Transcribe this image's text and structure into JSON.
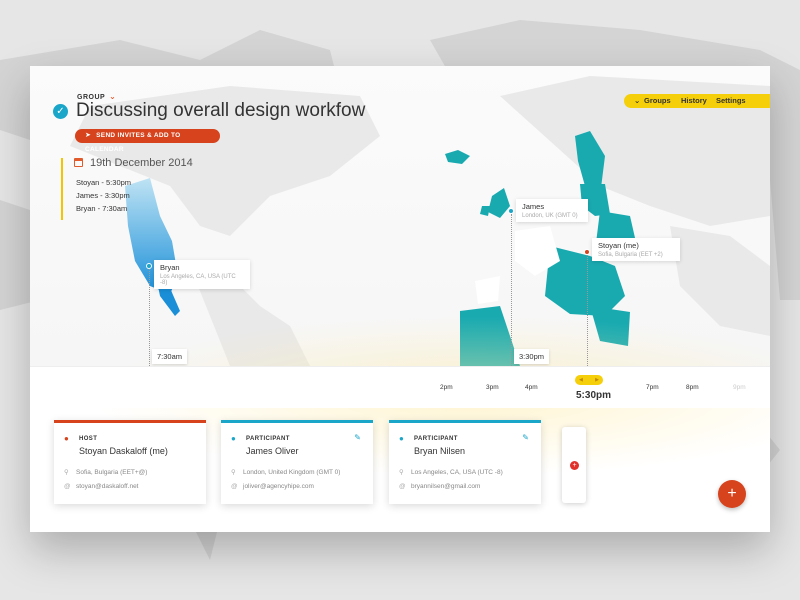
{
  "header": {
    "group_label": "GROUP",
    "title": "Discussing overall design workfow",
    "invite_button": "SEND INVITES & ADD TO CALENDAR"
  },
  "nav": {
    "groups": "Groups",
    "history": "History",
    "settings": "Settings"
  },
  "date": "19th December 2014",
  "times": [
    "Stoyan - 5:30pm",
    "James - 3:30pm",
    "Bryan - 7:30am"
  ],
  "pins": [
    {
      "name": "Bryan",
      "location": "Los Angeles, CA, USA (UTC -8)",
      "time": "7:30am"
    },
    {
      "name": "James",
      "location": "London, UK (GMT 0)",
      "time": "3:30pm"
    },
    {
      "name": "Stoyan (me)",
      "location": "Sofia, Bulgaria (EET +2)"
    }
  ],
  "timeline": {
    "ticks": [
      "2pm",
      "3pm",
      "4pm",
      "7pm",
      "8pm",
      "9pm"
    ],
    "current": "5:30pm"
  },
  "participants": [
    {
      "role": "HOST",
      "name": "Stoyan Daskaloff (me)",
      "location": "Sofia, Bulgaria (EET+@)",
      "email": "stoyan@daskaloff.net",
      "color": "#d6431d"
    },
    {
      "role": "PARTICIPANT",
      "name": "James Oliver",
      "location": "London, United Kingdom (GMT 0)",
      "email": "joliver@agencyhipe.com",
      "color": "#1aa6c9"
    },
    {
      "role": "PARTICIPANT",
      "name": "Bryan Nilsen",
      "location": "Los Angeles, CA, USA (UTC -8)",
      "email": "bryannilsen@gmail.com",
      "color": "#1aa6c9"
    }
  ],
  "colors": {
    "accent": "#d6431d",
    "teal": "#1aa6c9",
    "yellow": "#f5cf0a"
  }
}
